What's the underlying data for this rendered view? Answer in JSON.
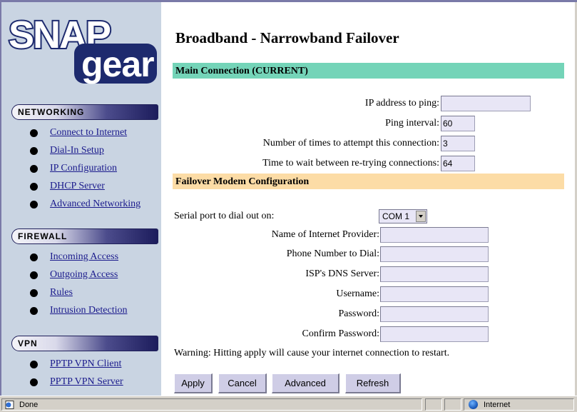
{
  "logo": {
    "text_top": "SNAP",
    "text_bottom": "gear"
  },
  "sidebar": {
    "sections": [
      {
        "title": "NETWORKING",
        "items": [
          "Connect to Internet",
          "Dial-In Setup",
          "IP Configuration",
          "DHCP Server",
          "Advanced Networking"
        ]
      },
      {
        "title": "FIREWALL",
        "items": [
          "Incoming Access",
          "Outgoing Access",
          "Rules",
          "Intrusion Detection"
        ]
      },
      {
        "title": "VPN",
        "items": [
          "PPTP VPN Client",
          "PPTP VPN Server"
        ]
      }
    ]
  },
  "main": {
    "title": "Broadband - Narrowband Failover",
    "main_connection": {
      "heading": "Main Connection (CURRENT)",
      "fields": [
        {
          "label": "IP address to ping:",
          "value": ""
        },
        {
          "label": "Ping interval:",
          "value": "60"
        },
        {
          "label": "Number of times to attempt this connection:",
          "value": "3"
        },
        {
          "label": "Time to wait between re-trying connections:",
          "value": "64"
        }
      ]
    },
    "modem": {
      "heading": "Failover Modem Configuration",
      "serial_port_label": "Serial port to dial out on:",
      "serial_port_value": "COM 1",
      "fields": [
        {
          "label": "Name of Internet Provider:",
          "value": ""
        },
        {
          "label": "Phone Number to Dial:",
          "value": ""
        },
        {
          "label": "ISP's DNS Server:",
          "value": ""
        },
        {
          "label": "Username:",
          "value": ""
        },
        {
          "label": "Password:",
          "value": ""
        },
        {
          "label": "Confirm Password:",
          "value": ""
        }
      ]
    },
    "warning": "Warning: Hitting apply will cause your internet connection to restart.",
    "buttons": {
      "apply": "Apply",
      "cancel": "Cancel",
      "advanced": "Advanced",
      "refresh": "Refresh"
    }
  },
  "statusbar": {
    "status": "Done",
    "zone": "Internet"
  },
  "colors": {
    "sidebar_bg": "#c9d4e2",
    "main_band": "#74d4b8",
    "modem_band": "#fcdca6",
    "field_bg": "#e8e6f6",
    "link": "#1a1a8c"
  }
}
